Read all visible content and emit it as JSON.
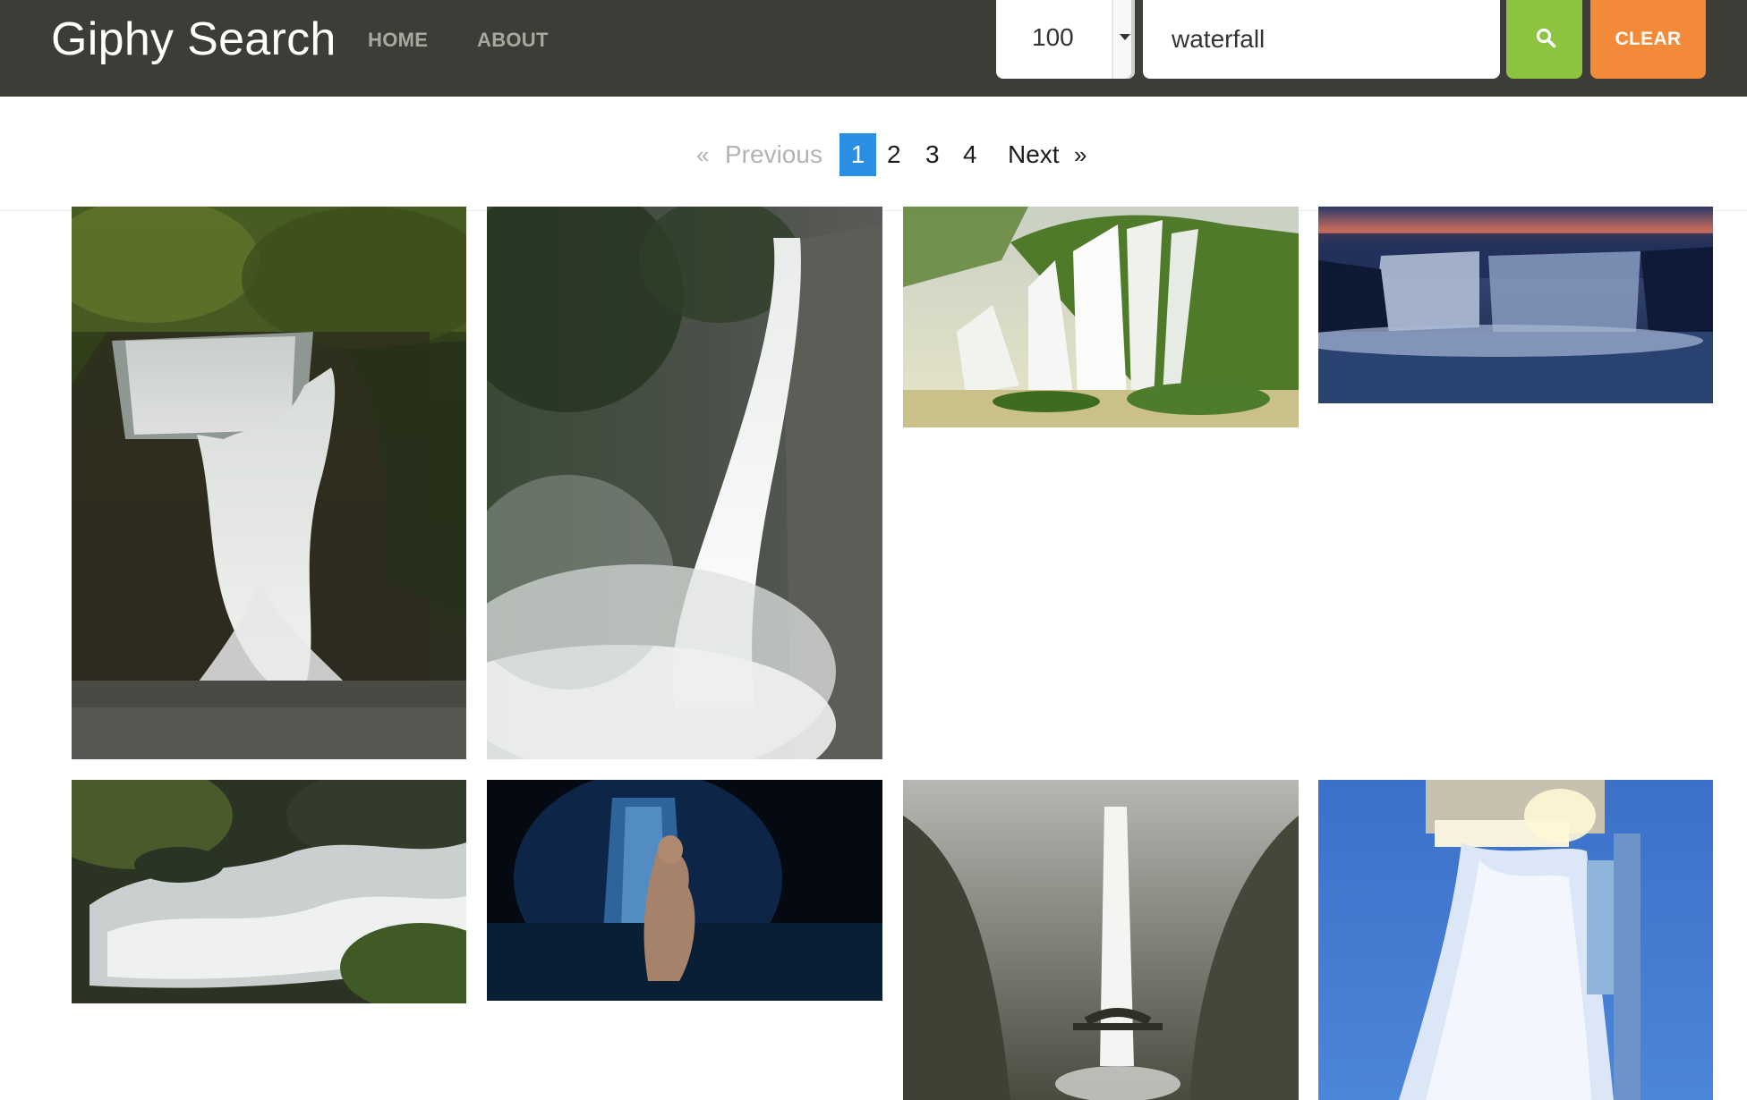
{
  "navbar": {
    "brand": "Giphy Search",
    "links": [
      "HOME",
      "ABOUT"
    ]
  },
  "search": {
    "limit": "100",
    "query": "waterfall",
    "search_icon": "search-icon",
    "clear_label": "CLEAR"
  },
  "pagination": {
    "prev_arrow": "«",
    "prev_label": "Previous",
    "pages": [
      "1",
      "2",
      "3",
      "4"
    ],
    "current_page": "1",
    "next_label": "Next",
    "next_arrow": "»"
  },
  "colors": {
    "navbar_bg": "#3d3c37",
    "search_button": "#8cc43f",
    "clear_button": "#f38a3a",
    "active_page": "#2a8ee3"
  }
}
